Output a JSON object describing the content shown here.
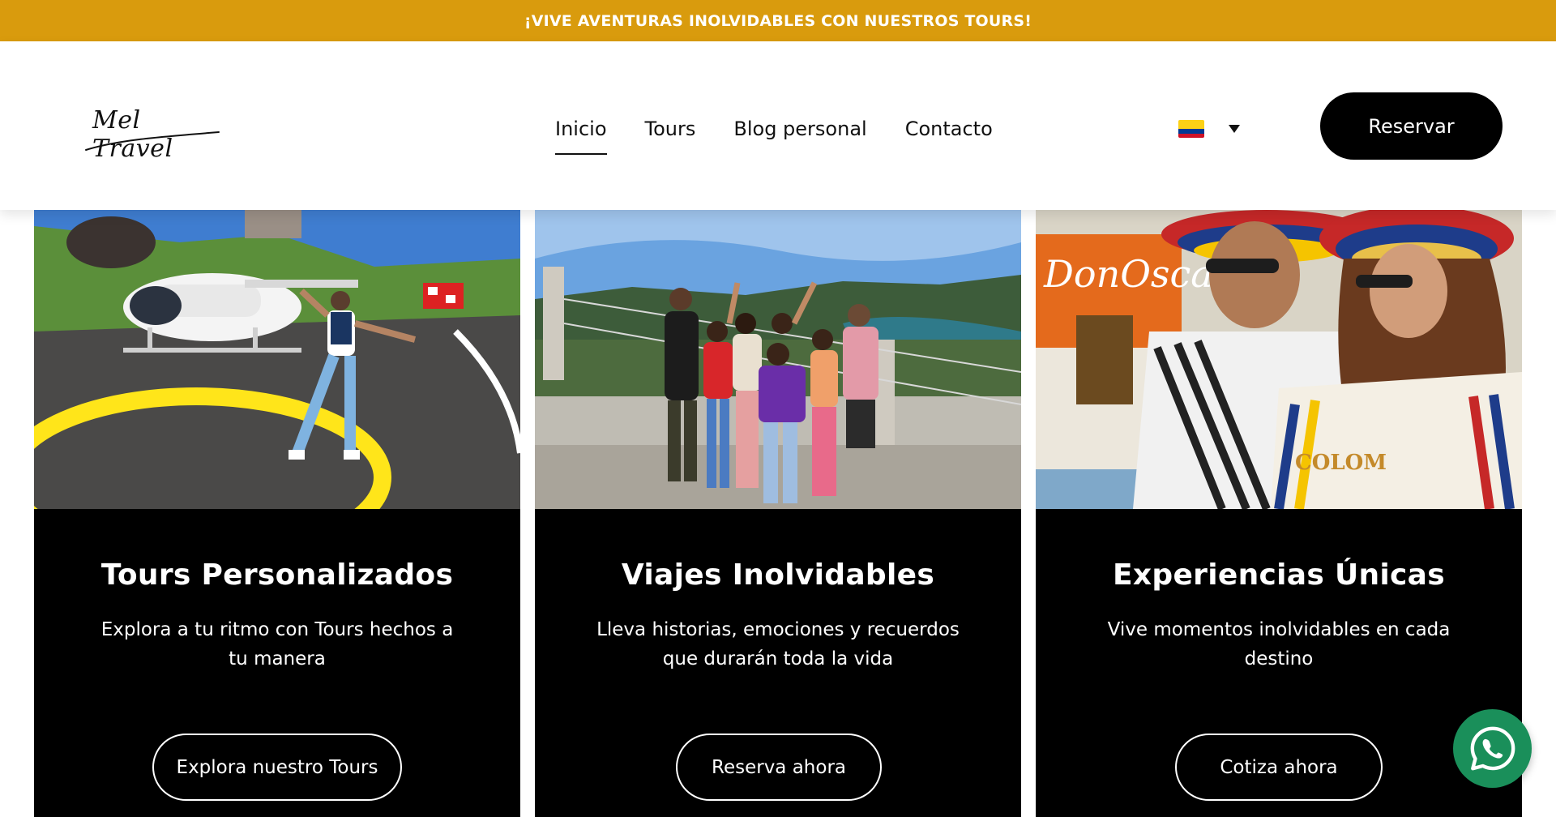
{
  "announcement": {
    "text": "¡VIVE AVENTURAS INOLVIDABLES CON NUESTROS TOURS!"
  },
  "header": {
    "logo_text": "Mel Travel",
    "nav": [
      {
        "label": "Inicio",
        "active": true
      },
      {
        "label": "Tours",
        "active": false
      },
      {
        "label": "Blog personal",
        "active": false
      },
      {
        "label": "Contacto",
        "active": false
      }
    ],
    "language_flag_icon": "colombia-flag-icon",
    "reserve_label": "Reservar"
  },
  "cards": [
    {
      "image_icon": "helicopter-tour-photo",
      "title": "Tours Personalizados",
      "text": "Explora a tu ritmo con Tours hechos a tu manera",
      "button": "Explora nuestro Tours"
    },
    {
      "image_icon": "group-viewpoint-photo",
      "title": "Viajes Inolvidables",
      "text": "Lleva historias, emociones y recuerdos que durarán toda la vida",
      "button": "Reserva ahora"
    },
    {
      "image_icon": "couple-colombian-hats-photo",
      "title": "Experiencias Únicas",
      "text": "Vive momentos inolvidables en cada destino",
      "button": "Cotiza ahora"
    }
  ],
  "floating": {
    "icon": "whatsapp-icon"
  },
  "colors": {
    "announcement_bg": "#d99b0d",
    "card_bg": "#000000",
    "whatsapp_green": "#1a8f5a"
  }
}
